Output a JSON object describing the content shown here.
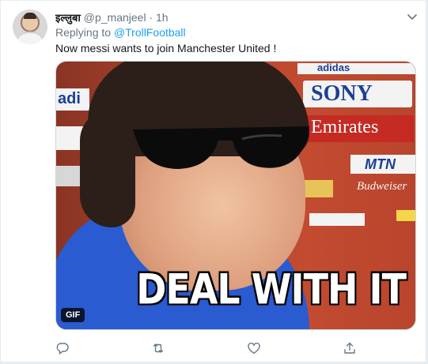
{
  "tweet": {
    "display_name": "इल्लुबा",
    "handle": "@p_manjeel",
    "separator": "·",
    "time": "1h",
    "replying_label": "Replying to",
    "replying_to": "@TrollFootball",
    "text": "Now messi wants to join Manchester United !"
  },
  "media": {
    "badge": "GIF",
    "caption": "DEAL WITH IT",
    "sponsors": [
      "adidas",
      "SONY",
      "Emirates",
      "MTN",
      "Budweiser",
      "adi"
    ]
  },
  "actions": [
    "reply-icon",
    "retweet-icon",
    "like-icon",
    "share-icon"
  ],
  "colors": {
    "accent": "#1da1f2",
    "secondary_text": "#657786",
    "primary_text": "#14171a"
  }
}
